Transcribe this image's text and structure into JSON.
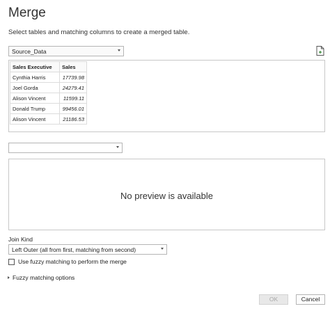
{
  "dialog": {
    "title": "Merge",
    "subtitle": "Select tables and matching columns to create a merged table."
  },
  "first_table": {
    "selected": "Source_Data",
    "columns": [
      "Sales Executive",
      "Sales"
    ],
    "rows": [
      [
        "Cynthia Harris",
        "17739.98"
      ],
      [
        "Joel Gorda",
        "24279.41"
      ],
      [
        "Alison Vincent",
        "11599.11"
      ],
      [
        "Donald Trump",
        "99456.01"
      ],
      [
        "Alison Vincent",
        "21186.53"
      ]
    ]
  },
  "second_table": {
    "selected": "",
    "preview_message": "No preview is available"
  },
  "join": {
    "label": "Join Kind",
    "selected": "Left Outer (all from first, matching from second)",
    "fuzzy_checkbox_label": "Use fuzzy matching to perform the merge",
    "fuzzy_checked": false,
    "fuzzy_options_label": "Fuzzy matching options"
  },
  "buttons": {
    "ok": "OK",
    "cancel": "Cancel"
  },
  "icons": {
    "file": "file-icon",
    "caret": "chevron-down-icon",
    "expand": "triangle-right-icon"
  }
}
